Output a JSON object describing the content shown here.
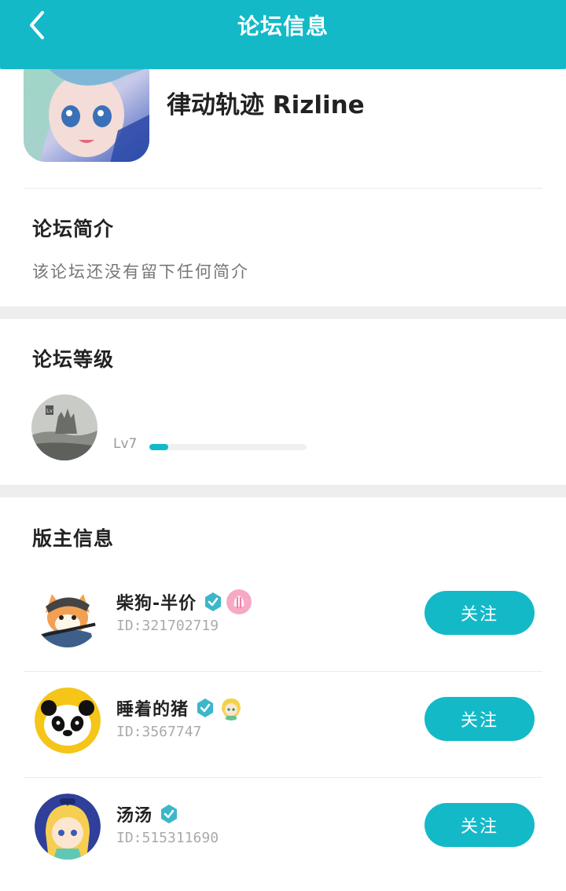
{
  "header": {
    "title": "论坛信息",
    "back_icon": "chevron-left-icon"
  },
  "forum": {
    "name": "律动轨迹 Rizline"
  },
  "intro": {
    "title": "论坛简介",
    "text": "该论坛还没有留下任何简介"
  },
  "level": {
    "title": "论坛等级",
    "label": "Lv7",
    "progress": 0.12
  },
  "moderators": {
    "title": "版主信息",
    "items": [
      {
        "name": "柴狗-半价",
        "id": "ID:321702719",
        "follow_label": "关注",
        "verified": true,
        "badge": "pink-badge-icon"
      },
      {
        "name": "睡着的猪",
        "id": "ID:3567747",
        "follow_label": "关注",
        "verified": true,
        "badge": "anime-girl-badge-icon"
      },
      {
        "name": "汤汤",
        "id": "ID:515311690",
        "follow_label": "关注",
        "verified": true,
        "badge": ""
      }
    ]
  },
  "colors": {
    "accent": "#14b9c8",
    "band": "#eeeeee"
  }
}
